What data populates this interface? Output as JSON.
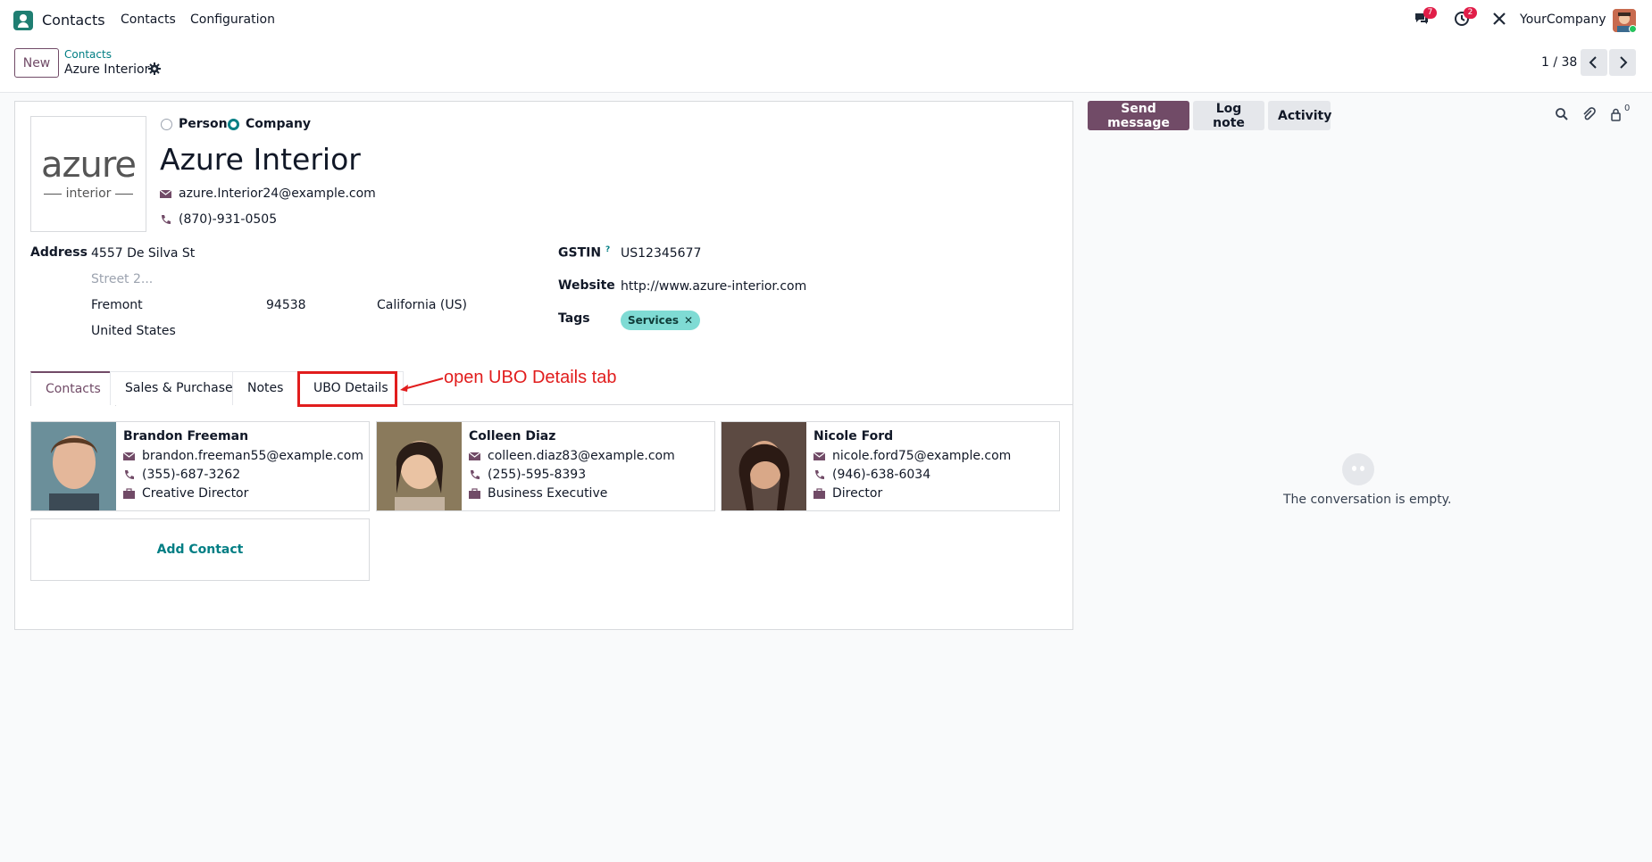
{
  "topbar": {
    "app_name": "Contacts",
    "menu": [
      "Contacts",
      "Configuration"
    ],
    "messages_badge": "7",
    "activities_badge": "2",
    "company": "YourCompany",
    "icons": [
      "chat-icon",
      "clock-icon",
      "tools-icon"
    ]
  },
  "control": {
    "new_label": "New",
    "breadcrumb_parent": "Contacts",
    "breadcrumb_current": "Azure Interior",
    "pager": "1 / 38"
  },
  "form": {
    "type_person": "Person",
    "type_company": "Company",
    "selected_type": "Company",
    "name": "Azure Interior",
    "logo_word": "azure",
    "logo_sub": "interior",
    "email": "azure.Interior24@example.com",
    "phone": "(870)-931-0505",
    "address_label": "Address",
    "street": "4557 De Silva St",
    "street2_placeholder": "Street 2...",
    "city": "Fremont",
    "zip": "94538",
    "state": "California (US)",
    "country": "United States",
    "gstin_label": "GSTIN",
    "gstin_help": "?",
    "gstin": "US12345677",
    "website_label": "Website",
    "website": "http://www.azure-interior.com",
    "tags_label": "Tags",
    "tag": "Services",
    "tag_remove": "✕"
  },
  "tabs": [
    "Contacts",
    "Sales & Purchase",
    "Notes",
    "UBO Details"
  ],
  "active_tab": "Contacts",
  "annotation": "open UBO Details tab",
  "contacts": [
    {
      "name": "Brandon Freeman",
      "email": "brandon.freeman55@example.com",
      "phone": "(355)-687-3262",
      "job": "Creative Director"
    },
    {
      "name": "Colleen Diaz",
      "email": "colleen.diaz83@example.com",
      "phone": "(255)-595-8393",
      "job": "Business Executive"
    },
    {
      "name": "Nicole Ford",
      "email": "nicole.ford75@example.com",
      "phone": "(946)-638-6034",
      "job": "Director"
    }
  ],
  "add_contact": "Add Contact",
  "chatter": {
    "send_message": "Send message",
    "log_note": "Log note",
    "activity": "Activity",
    "followers_count": "0",
    "empty_text": "The conversation is empty."
  },
  "colors": {
    "brand": "#714b67",
    "accent": "#017e84",
    "annotation": "#e11d1d",
    "tag_bg": "#7fdbd4"
  }
}
